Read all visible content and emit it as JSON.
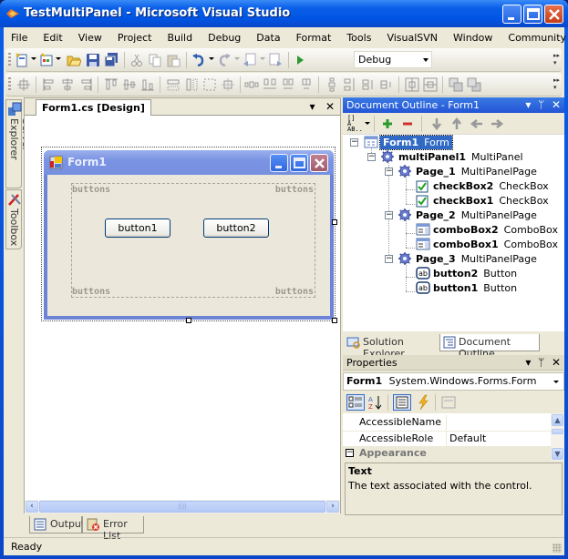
{
  "window": {
    "title": "TestMultiPanel - Microsoft Visual Studio"
  },
  "menu": [
    "File",
    "Edit",
    "View",
    "Project",
    "Build",
    "Debug",
    "Data",
    "Format",
    "Tools",
    "VisualSVN",
    "Window",
    "Community",
    "Help"
  ],
  "toolbar": {
    "config_value": "Debug",
    "standard_icons": [
      "new-project-icon",
      "add-item-icon",
      "open-file-icon",
      "save-icon",
      "save-all-icon",
      "cut-icon",
      "copy-icon",
      "paste-icon",
      "undo-icon",
      "redo-icon",
      "navigate-backward-icon",
      "navigate-forward-icon",
      "start-debugging-icon"
    ],
    "layout_icons": [
      "align-to-grid-icon",
      "align-lefts-icon",
      "align-centers-icon",
      "align-rights-icon",
      "align-tops-icon",
      "align-middles-icon",
      "align-bottoms-icon",
      "make-same-width-icon",
      "make-same-height-icon",
      "size-to-grid-icon",
      "make-same-size-icon",
      "horizontal-spacing-equal-icon",
      "increase-horizontal-spacing-icon",
      "decrease-horizontal-spacing-icon",
      "remove-horizontal-spacing-icon",
      "vertical-spacing-equal-icon",
      "increase-vertical-spacing-icon",
      "decrease-vertical-spacing-icon",
      "remove-vertical-spacing-icon",
      "center-horizontally-icon",
      "center-vertically-icon",
      "bring-to-front-icon",
      "send-to-back-icon"
    ]
  },
  "sidebar": {
    "tabs": [
      {
        "label": "Server Explorer",
        "icon": "server-explorer-icon"
      },
      {
        "label": "Toolbox",
        "icon": "toolbox-icon"
      }
    ]
  },
  "document": {
    "tab_label": "Form1.cs [Design]",
    "form": {
      "title": "Form1",
      "multipanel_label": "buttons",
      "buttons": [
        "button1",
        "button2"
      ]
    }
  },
  "bottom_tabs": [
    {
      "label": "Output",
      "icon": "output-icon"
    },
    {
      "label": "Error List",
      "icon": "error-list-icon"
    }
  ],
  "status": {
    "text": "Ready"
  },
  "outline": {
    "title": "Document Outline - Form1",
    "tree": [
      {
        "name": "Form1",
        "type": "Form",
        "level": 0,
        "icon": "form-icon",
        "selected": true
      },
      {
        "name": "multiPanel1",
        "type": "MultiPanel",
        "level": 1,
        "icon": "component-icon"
      },
      {
        "name": "Page_1",
        "type": "MultiPanelPage",
        "level": 2,
        "icon": "component-icon"
      },
      {
        "name": "checkBox2",
        "type": "CheckBox",
        "level": 3,
        "icon": "checkbox-icon"
      },
      {
        "name": "checkBox1",
        "type": "CheckBox",
        "level": 3,
        "icon": "checkbox-icon"
      },
      {
        "name": "Page_2",
        "type": "MultiPanelPage",
        "level": 2,
        "icon": "component-icon"
      },
      {
        "name": "comboBox2",
        "type": "ComboBox",
        "level": 3,
        "icon": "combobox-icon"
      },
      {
        "name": "comboBox1",
        "type": "ComboBox",
        "level": 3,
        "icon": "combobox-icon"
      },
      {
        "name": "Page_3",
        "type": "MultiPanelPage",
        "level": 2,
        "icon": "component-icon"
      },
      {
        "name": "button2",
        "type": "Button",
        "level": 3,
        "icon": "button-icon"
      },
      {
        "name": "button1",
        "type": "Button",
        "level": 3,
        "icon": "button-icon"
      }
    ],
    "tabs": [
      {
        "label": "Solution Explorer",
        "icon": "solution-explorer-icon"
      },
      {
        "label": "Document Outline",
        "icon": "document-outline-icon",
        "active": true
      }
    ]
  },
  "properties": {
    "title": "Properties",
    "object_name": "Form1",
    "object_type": "System.Windows.Forms.Form",
    "rows": [
      {
        "key": "AccessibleName",
        "value": ""
      },
      {
        "key": "AccessibleRole",
        "value": "Default"
      }
    ],
    "category": "Appearance",
    "description_title": "Text",
    "description_text": "The text associated with the control."
  }
}
